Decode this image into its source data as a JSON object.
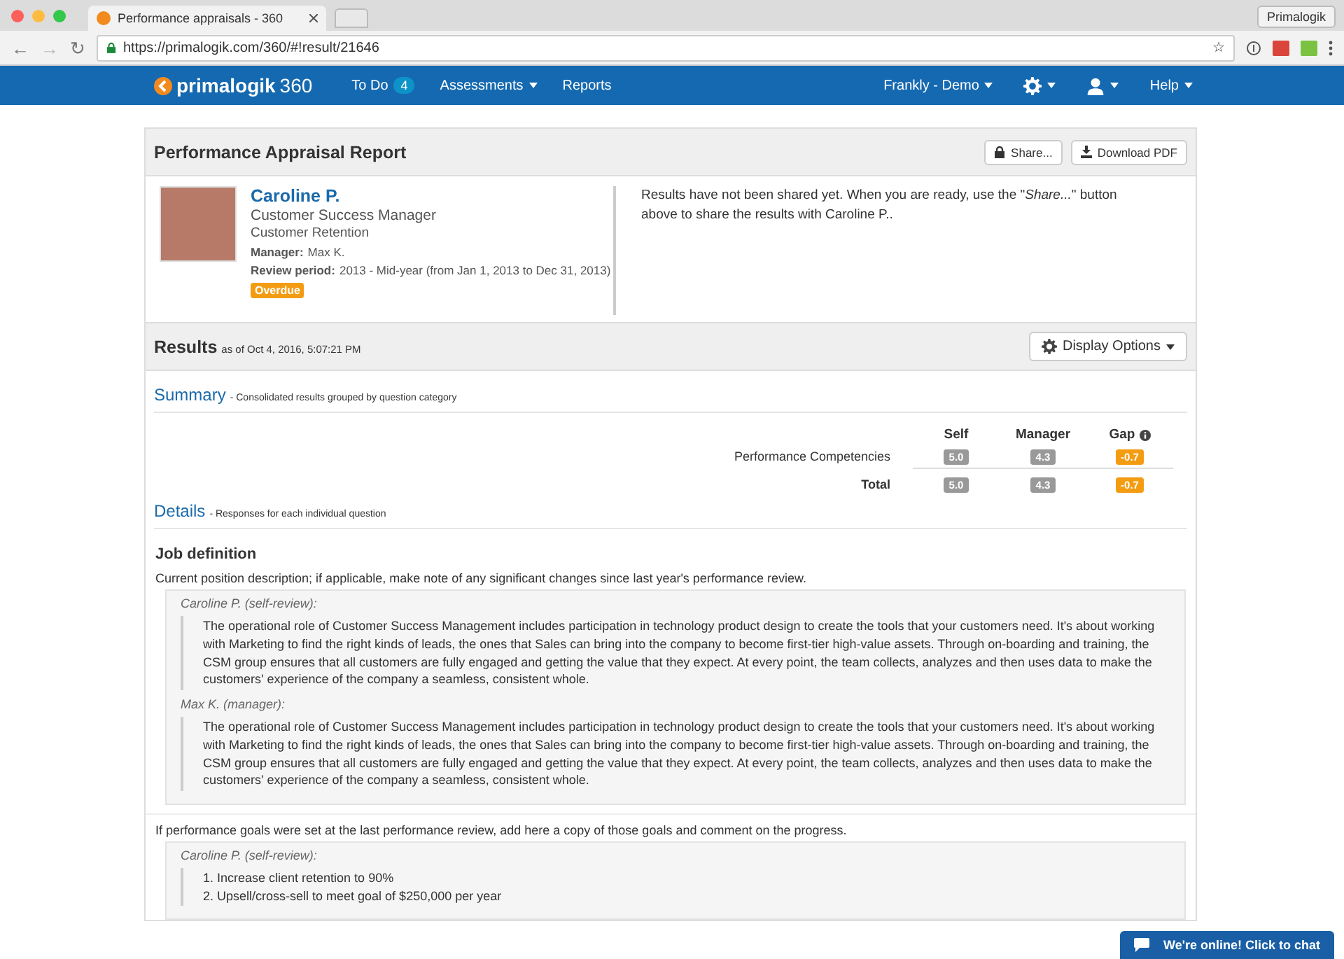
{
  "browser": {
    "tab_title": "Performance appraisals - 360",
    "profile_button": "Primalogik",
    "url": "https://primalogik.com/360/#!result/21646",
    "back": "←",
    "forward": "→",
    "reload": "↻",
    "star": "☆"
  },
  "nav": {
    "logo": "primalogik",
    "logo_suffix": "360",
    "left": [
      {
        "kind": "link",
        "label": "To Do",
        "badge": "4"
      },
      {
        "kind": "menu",
        "label": "Assessments"
      },
      {
        "kind": "link",
        "label": "Reports"
      }
    ],
    "right": [
      {
        "kind": "menu",
        "label": "Frankly - Demo"
      },
      {
        "kind": "gear"
      },
      {
        "kind": "user"
      },
      {
        "kind": "menu",
        "label": "Help"
      }
    ]
  },
  "report": {
    "title": "Performance Appraisal Report",
    "buttons": [
      {
        "kind": "lock",
        "label": "Share..."
      },
      {
        "kind": "download",
        "label": "Download PDF"
      }
    ],
    "employee": {
      "name": "Caroline P.",
      "role": "Customer Success Manager",
      "department": "Customer Retention",
      "manager_label": "Manager:",
      "manager": "Max K.",
      "review_label": "Review period:",
      "review": "2013 - Mid-year (from Jan 1, 2013 to Dec 31, 2013)",
      "status": "Overdue"
    },
    "notice": "Results have not been shared yet. When you are ready, use the \"*Share...*\" button above to share the results with Caroline P.."
  },
  "results": {
    "title": "Results",
    "timestamp": "as of Oct 4, 2016, 5:07:21 PM",
    "display_options": "Display Options"
  },
  "summary": {
    "title": "Summary",
    "subtitle": "- Consolidated results grouped by question category",
    "columns": [
      "Self",
      "Manager",
      "Gap"
    ],
    "rows": [
      {
        "kind": "category",
        "label": "Performance Competencies",
        "self": "5.0",
        "manager": "4.3",
        "gap": "-0.7"
      },
      {
        "kind": "total",
        "label": "Total",
        "self": "5.0",
        "manager": "4.3",
        "gap": "-0.7"
      }
    ]
  },
  "details": {
    "title": "Details",
    "subtitle": "- Responses for each individual question",
    "sections": [
      {
        "title": "Job definition",
        "question": "Current position description; if applicable, make note of any significant changes since last year's performance review.",
        "responses": [
          {
            "kind": "text",
            "author": "Caroline P. (self-review):",
            "text": "The operational role of Customer Success Management includes participation in technology product design to create the tools that your customers need. It's about working with Marketing to find the right kinds of leads, the ones that Sales can bring into the company to become first-tier high-value assets. Through on-boarding and training, the CSM group ensures that all customers are fully engaged and getting the value that they expect. At every point, the team collects, analyzes and then uses data to make the customers' experience of the company a seamless, consistent whole."
          },
          {
            "kind": "text",
            "author": "Max K. (manager):",
            "text": "The operational role of Customer Success Management includes participation in technology product design to create the tools that your customers need. It's about working with Marketing to find the right kinds of leads, the ones that Sales can bring into the company to become first-tier high-value assets. Through on-boarding and training, the CSM group ensures that all customers are fully engaged and getting the value that they expect. At every point, the team collects, analyzes and then uses data to make the customers' experience of the company a seamless, consistent whole."
          }
        ]
      },
      {
        "question": "If performance goals were set at the last performance review, add here a copy of those goals and comment on the progress.",
        "responses": [
          {
            "kind": "list",
            "author": "Caroline P. (self-review):",
            "items": [
              "1. Increase client retention to 90%",
              "2. Upsell/cross-sell to meet goal of $250,000 per year"
            ]
          }
        ]
      }
    ]
  },
  "chat": {
    "label": "We're online! Click to chat"
  }
}
